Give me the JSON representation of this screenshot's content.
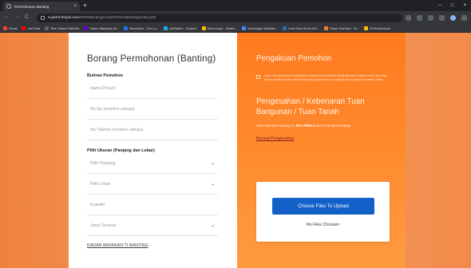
{
  "browser": {
    "tab_title": "Permohonan Banting",
    "tab_close": "×",
    "new_tab": "+",
    "win_min": "–",
    "win_max": "□",
    "win_close": "×",
    "nav_back": "←",
    "nav_forward": "→",
    "nav_reload": "C",
    "url_host": "e-permohnpd.com",
    "url_path": "/MPD/Banting/contoh/FormBanting/index.php",
    "bookmarks": [
      {
        "label": "Gmail",
        "icon": "gmail-icon",
        "color": "#ea4335"
      },
      {
        "label": "YouTube",
        "icon": "youtube-icon",
        "color": "#ff0000"
      },
      {
        "label": "Tech Talent Platform",
        "icon": "bookmark-icon",
        "color": "#5f6368"
      },
      {
        "label": "Yahoo Malaysia (N...",
        "icon": "yahoo-icon",
        "color": "#6001d2"
      },
      {
        "label": "NexusHot - The La...",
        "icon": "bookmark-icon",
        "color": "#1a73e8"
      },
      {
        "label": "ArtStation - Explore",
        "icon": "artstation-icon",
        "color": "#13aff0"
      },
      {
        "label": "Normomas - Watch...",
        "icon": "bookmark-icon",
        "color": "#fbbc04"
      },
      {
        "label": "Minoraptyr Website...",
        "icon": "bookmark-icon",
        "color": "#4285f4"
      },
      {
        "label": "Free Dust Stock Vid...",
        "icon": "bookmark-icon",
        "color": "#2b6cb0"
      },
      {
        "label": "Stack Overflow - W...",
        "icon": "stackoverflow-icon",
        "color": "#f48024"
      },
      {
        "label": "All Bookmarks",
        "icon": "folder-icon",
        "color": "#fbbc04"
      }
    ]
  },
  "form": {
    "title": "Borang Permohonan (Banting)",
    "section_applicant": "Butiran Pemohon",
    "name_placeholder": "Nama Penuh",
    "ic_placeholder": "No Kp (nombor sahaja)",
    "phone_placeholder": "No Telefon (nombor sahaja)",
    "section_size": "Pilih Ukuran (Panjang dan Lebar)",
    "length_select": "Pilih Panjang",
    "width_select": "Pilih Lebar",
    "quantity_placeholder": "Kuantiti",
    "material_select": "Jenis Smaran",
    "fees_link": "KADAR BAYARAN TI BANTING",
    "chevron": "⌄"
  },
  "info": {
    "title": "Pengakuan Pemohon",
    "declaration": "Saya, nam pemohon menyatakan bahawa semua butiran yang diberikan adalah benar, dan saya faham tindakan boleh diambil sekiranya permohonan ini dibuat secara palsu Pendaftar Tanah.",
    "title2": "Pengesahan / Kebenaran Tuan Bangunan / Tuan Tanah",
    "desc_prefix": "Sila muat turun borang ini ",
    "desc_bold": "JIKA PERLU",
    "desc_suffix": " dan isi dengan lengkap",
    "confirm_link": "Borang Pengesahan",
    "upload_button": "Choose Files To Upload",
    "no_files": "No Files Choosen"
  }
}
